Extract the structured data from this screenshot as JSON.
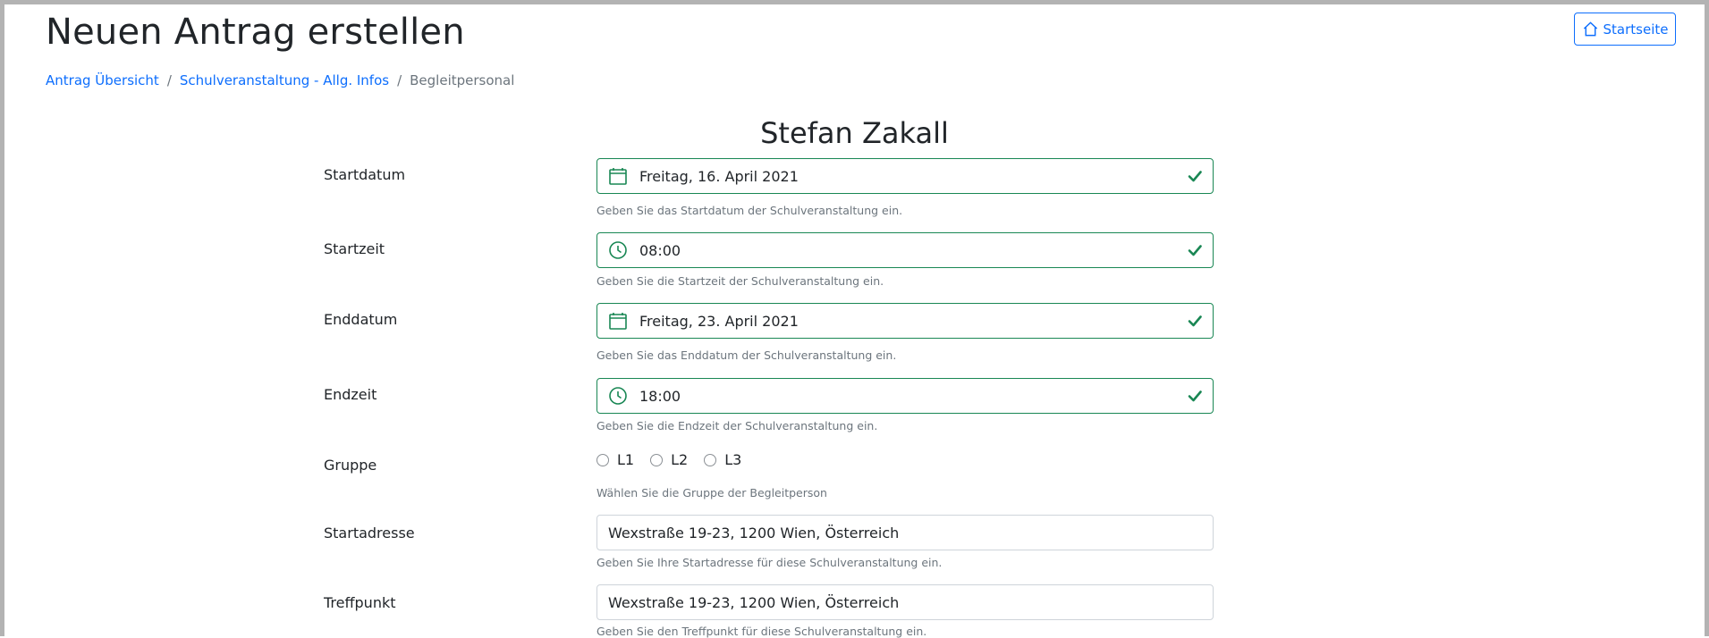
{
  "header": {
    "title": "Neuen Antrag erstellen",
    "home_button": "Startseite"
  },
  "breadcrumb": {
    "items": [
      "Antrag Übersicht",
      "Schulveranstaltung - Allg. Infos",
      "Begleitpersonal"
    ],
    "separator": "/"
  },
  "person_name": "Stefan Zakall",
  "colors": {
    "valid": "#198754",
    "link": "#0d6efd",
    "muted": "#6c757d"
  },
  "form": {
    "startdatum": {
      "label": "Startdatum",
      "value": "Freitag, 16. April 2021",
      "help": "Geben Sie das Startdatum der Schulveranstaltung ein.",
      "icon": "calendar-icon"
    },
    "startzeit": {
      "label": "Startzeit",
      "value": "08:00",
      "help": "Geben Sie die Startzeit der Schulveranstaltung ein.",
      "icon": "clock-icon"
    },
    "enddatum": {
      "label": "Enddatum",
      "value": "Freitag, 23. April 2021",
      "help": "Geben Sie das Enddatum der Schulveranstaltung ein.",
      "icon": "calendar-icon"
    },
    "endzeit": {
      "label": "Endzeit",
      "value": "18:00",
      "help": "Geben Sie die Endzeit der Schulveranstaltung ein.",
      "icon": "clock-icon"
    },
    "gruppe": {
      "label": "Gruppe",
      "options": [
        "L1",
        "L2",
        "L3"
      ],
      "help": "Wählen Sie die Gruppe der Begleitperson"
    },
    "startadresse": {
      "label": "Startadresse",
      "value": "Wexstraße 19-23, 1200 Wien, Österreich",
      "help": "Geben Sie Ihre Startadresse für diese Schulveranstaltung ein."
    },
    "treffpunkt": {
      "label": "Treffpunkt",
      "value": "Wexstraße 19-23, 1200 Wien, Österreich",
      "help": "Geben Sie den Treffpunkt für diese Schulveranstaltung ein."
    }
  }
}
